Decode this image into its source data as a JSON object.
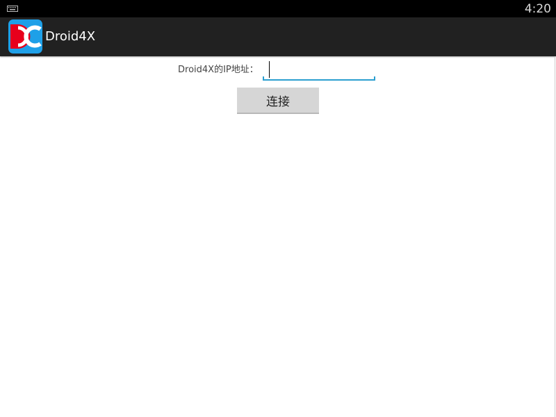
{
  "status_bar": {
    "time": "4:20",
    "left_icon": "keyboard-icon"
  },
  "action_bar": {
    "title": "Droid4X",
    "logo_icon": "droid4x-logo-icon",
    "logo_colors": {
      "red": "#e8001c",
      "blue": "#1ea0e8",
      "white": "#ffffff"
    }
  },
  "form": {
    "ip_label": "Droid4X的IP地址：",
    "ip_value": "",
    "ip_placeholder": "",
    "connect_label": "连接"
  },
  "colors": {
    "status_bar_bg": "#000000",
    "action_bar_bg": "#212121",
    "input_underline": "#2b9fd0",
    "button_bg": "#d6d6d6"
  }
}
